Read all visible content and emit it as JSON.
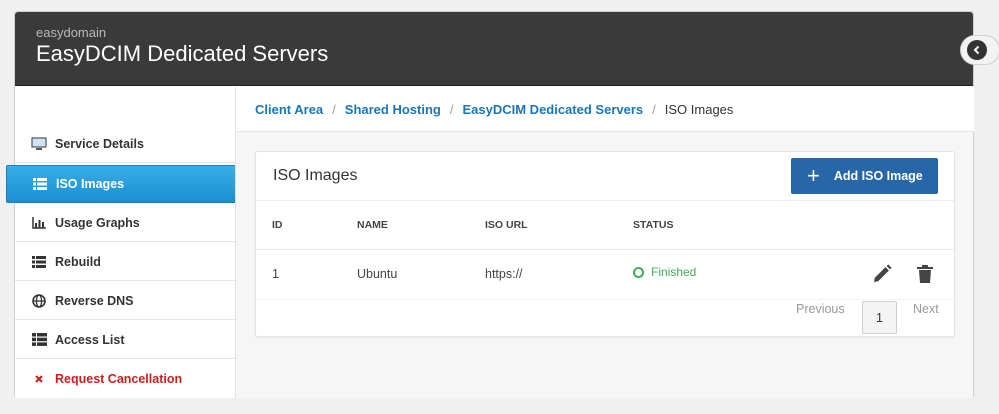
{
  "header": {
    "brand": "easydomain",
    "title": "EasyDCIM Dedicated Servers"
  },
  "sidebar": {
    "items": [
      {
        "label": "Service Details",
        "icon": "monitor-icon"
      },
      {
        "label": "ISO Images",
        "icon": "list-icon",
        "active": true
      },
      {
        "label": "Usage Graphs",
        "icon": "bar-chart-icon"
      },
      {
        "label": "Rebuild",
        "icon": "list-icon"
      },
      {
        "label": "Reverse DNS",
        "icon": "globe-icon"
      },
      {
        "label": "Access List",
        "icon": "table-icon"
      },
      {
        "label": "Request Cancellation",
        "icon": "close-icon"
      }
    ]
  },
  "breadcrumb": {
    "items": [
      "Client Area",
      "Shared Hosting",
      "EasyDCIM Dedicated Servers"
    ],
    "separator": "/",
    "current": "ISO Images"
  },
  "panel": {
    "title": "ISO Images",
    "add_button": "Add ISO Image",
    "columns": [
      "ID",
      "NAME",
      "ISO URL",
      "STATUS"
    ],
    "rows": [
      {
        "id": "1",
        "name": "Ubuntu",
        "url": "https://",
        "status": "Finished"
      }
    ]
  },
  "pagination": {
    "previous": "Previous",
    "current_page": "1",
    "next": "Next"
  },
  "colors": {
    "header_bg": "#3a3a3a",
    "active_item": "#1a8fd0",
    "primary_button": "#2766a8",
    "link": "#1b75bb",
    "success": "#3eae55",
    "danger": "#c9211e"
  }
}
